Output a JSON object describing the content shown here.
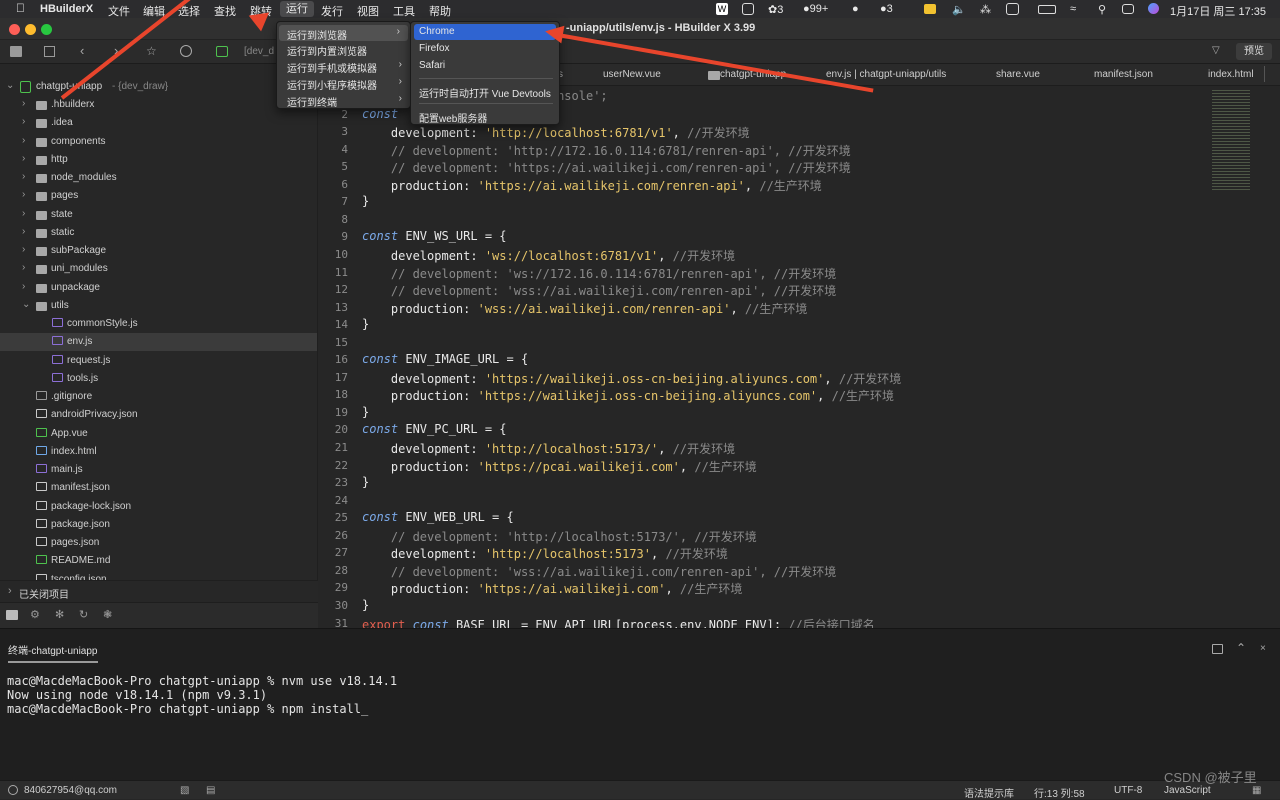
{
  "menubar": {
    "app_name": "HBuilderX",
    "items": [
      "文件",
      "编辑",
      "选择",
      "查找",
      "跳转",
      "运行",
      "发行",
      "视图",
      "工具",
      "帮助"
    ],
    "status_icons": [
      "3",
      "99+",
      "3"
    ],
    "clock": "1月17日 周三  17:35"
  },
  "window": {
    "title": "-uniapp/utils/env.js - HBuilder X 3.99",
    "preview_button": "预览",
    "path_hint": "[dev_d"
  },
  "editor_tabs": [
    "s",
    "userNew.vue",
    "chatgpt-uniapp",
    "env.js | chatgpt-uniapp/utils",
    "share.vue",
    "manifest.json",
    "index.html"
  ],
  "run_menu": {
    "items": [
      {
        "label": "运行到浏览器",
        "has_submenu": true
      },
      {
        "label": "运行到内置浏览器",
        "has_submenu": false
      },
      {
        "label": "运行到手机或模拟器",
        "has_submenu": true
      },
      {
        "label": "运行到小程序模拟器",
        "has_submenu": true
      },
      {
        "label": "运行到终端",
        "has_submenu": true
      }
    ]
  },
  "browser_menu": {
    "items": [
      "Chrome",
      "Firefox",
      "Safari",
      "运行时自动打开 Vue Devtools",
      "配置web服务器"
    ]
  },
  "project": {
    "name": "chatgpt-uniapp",
    "tag": "- {dev_draw}"
  },
  "tree": [
    {
      "label": ".hbuilderx",
      "type": "folder",
      "depth": 1
    },
    {
      "label": ".idea",
      "type": "folder",
      "depth": 1
    },
    {
      "label": "components",
      "type": "folder",
      "depth": 1
    },
    {
      "label": "http",
      "type": "folder",
      "depth": 1
    },
    {
      "label": "node_modules",
      "type": "folder",
      "depth": 1
    },
    {
      "label": "pages",
      "type": "folder",
      "depth": 1
    },
    {
      "label": "state",
      "type": "folder",
      "depth": 1
    },
    {
      "label": "static",
      "type": "folder",
      "depth": 1
    },
    {
      "label": "subPackage",
      "type": "folder",
      "depth": 1
    },
    {
      "label": "uni_modules",
      "type": "folder",
      "depth": 1
    },
    {
      "label": "unpackage",
      "type": "folder",
      "depth": 1
    },
    {
      "label": "utils",
      "type": "folder-open",
      "depth": 1
    },
    {
      "label": "commonStyle.js",
      "type": "js",
      "depth": 2
    },
    {
      "label": "env.js",
      "type": "js",
      "depth": 2,
      "selected": true
    },
    {
      "label": "request.js",
      "type": "js",
      "depth": 2
    },
    {
      "label": "tools.js",
      "type": "js",
      "depth": 2
    },
    {
      "label": ".gitignore",
      "type": "file",
      "depth": 1
    },
    {
      "label": "androidPrivacy.json",
      "type": "json",
      "depth": 1
    },
    {
      "label": "App.vue",
      "type": "vue",
      "depth": 1
    },
    {
      "label": "index.html",
      "type": "html",
      "depth": 1
    },
    {
      "label": "main.js",
      "type": "js",
      "depth": 1
    },
    {
      "label": "manifest.json",
      "type": "json",
      "depth": 1
    },
    {
      "label": "package-lock.json",
      "type": "json",
      "depth": 1
    },
    {
      "label": "package.json",
      "type": "json",
      "depth": 1
    },
    {
      "label": "pages.json",
      "type": "json",
      "depth": 1
    },
    {
      "label": "README.md",
      "type": "md",
      "depth": 1
    },
    {
      "label": "tsconfig.json",
      "type": "json",
      "depth": 1
    }
  ],
  "closed_projects": "已关闭项目",
  "code": {
    "start_line": 1,
    "lines": [
      [
        [
          "c",
          "                          onsole';"
        ]
      ],
      [
        [
          "k",
          "const"
        ],
        [
          "p",
          " "
        ]
      ],
      [
        [
          "p",
          "    development: "
        ],
        [
          "s",
          "'http://localhost:6781/v1'"
        ],
        [
          "p",
          ", "
        ],
        [
          "c",
          "//开发环境"
        ]
      ],
      [
        [
          "c",
          "    // development: 'http://172.16.0.114:6781/renren-api', //开发环境"
        ]
      ],
      [
        [
          "c",
          "    // development: 'https://ai.wailikeji.com/renren-api', //开发环境"
        ]
      ],
      [
        [
          "p",
          "    production: "
        ],
        [
          "s",
          "'https://ai.wailikeji.com/renren-api'"
        ],
        [
          "p",
          ", "
        ],
        [
          "c",
          "//生产环境"
        ]
      ],
      [
        [
          "p",
          "}"
        ]
      ],
      [
        [
          "p",
          ""
        ]
      ],
      [
        [
          "k",
          "const"
        ],
        [
          "p",
          " ENV_WS_URL = {"
        ]
      ],
      [
        [
          "p",
          "    development: "
        ],
        [
          "s",
          "'ws://localhost:6781/v1'"
        ],
        [
          "p",
          ", "
        ],
        [
          "c",
          "//开发环境"
        ]
      ],
      [
        [
          "c",
          "    // development: 'ws://172.16.0.114:6781/renren-api', //开发环境"
        ]
      ],
      [
        [
          "c",
          "    // development: 'wss://ai.wailikeji.com/renren-api', //开发环境"
        ]
      ],
      [
        [
          "p",
          "    production: "
        ],
        [
          "s",
          "'wss://ai.wailikeji.com/renren-api'"
        ],
        [
          "p",
          ", "
        ],
        [
          "c",
          "//生产环境"
        ]
      ],
      [
        [
          "p",
          "}"
        ]
      ],
      [
        [
          "p",
          ""
        ]
      ],
      [
        [
          "k",
          "const"
        ],
        [
          "p",
          " ENV_IMAGE_URL = {"
        ]
      ],
      [
        [
          "p",
          "    development: "
        ],
        [
          "s",
          "'https://wailikeji.oss-cn-beijing.aliyuncs.com'"
        ],
        [
          "p",
          ", "
        ],
        [
          "c",
          "//开发环境"
        ]
      ],
      [
        [
          "p",
          "    production: "
        ],
        [
          "s",
          "'https://wailikeji.oss-cn-beijing.aliyuncs.com'"
        ],
        [
          "p",
          ", "
        ],
        [
          "c",
          "//生产环境"
        ]
      ],
      [
        [
          "p",
          "}"
        ]
      ],
      [
        [
          "k",
          "const"
        ],
        [
          "p",
          " ENV_PC_URL = {"
        ]
      ],
      [
        [
          "p",
          "    development: "
        ],
        [
          "s",
          "'http://localhost:5173/'"
        ],
        [
          "p",
          ", "
        ],
        [
          "c",
          "//开发环境"
        ]
      ],
      [
        [
          "p",
          "    production: "
        ],
        [
          "s",
          "'https://pcai.wailikeji.com'"
        ],
        [
          "p",
          ", "
        ],
        [
          "c",
          "//生产环境"
        ]
      ],
      [
        [
          "p",
          "}"
        ]
      ],
      [
        [
          "p",
          ""
        ]
      ],
      [
        [
          "k",
          "const"
        ],
        [
          "p",
          " ENV_WEB_URL = {"
        ]
      ],
      [
        [
          "c",
          "    // development: 'http://localhost:5173/', //开发环境"
        ]
      ],
      [
        [
          "p",
          "    development: "
        ],
        [
          "s",
          "'http://localhost:5173'"
        ],
        [
          "p",
          ", "
        ],
        [
          "c",
          "//开发环境"
        ]
      ],
      [
        [
          "c",
          "    // development: 'wss://ai.wailikeji.com/renren-api', //开发环境"
        ]
      ],
      [
        [
          "p",
          "    production: "
        ],
        [
          "s",
          "'https://ai.wailikeji.com'"
        ],
        [
          "p",
          ", "
        ],
        [
          "c",
          "//生产环境"
        ]
      ],
      [
        [
          "p",
          "}"
        ]
      ],
      [
        [
          "e",
          "export"
        ],
        [
          "p",
          " "
        ],
        [
          "k",
          "const"
        ],
        [
          "p",
          " BASE_URL = ENV_API_URL[process.env.NODE_ENV]; "
        ],
        [
          "c",
          "//后台接口域名"
        ]
      ]
    ]
  },
  "terminal": {
    "tab": "终端-chatgpt-uniapp",
    "lines": [
      "mac@MacdeMacBook-Pro chatgpt-uniapp % nvm use v18.14.1",
      "Now using node v18.14.1 (npm v9.3.1)",
      "mac@MacdeMacBook-Pro chatgpt-uniapp % npm install_"
    ]
  },
  "statusbar": {
    "account": "840627954@qq.com",
    "syntax_hint": "语法提示库",
    "position": "行:13  列:58",
    "encoding": "UTF-8",
    "language": "JavaScript",
    "watermark": "CSDN @被子里"
  },
  "colors": {
    "accent": "#2f64d1",
    "annotation_arrow": "#e8452c",
    "string": "#e6c56a",
    "keyword": "#7ba9e8",
    "comment": "#8a8a8a"
  }
}
